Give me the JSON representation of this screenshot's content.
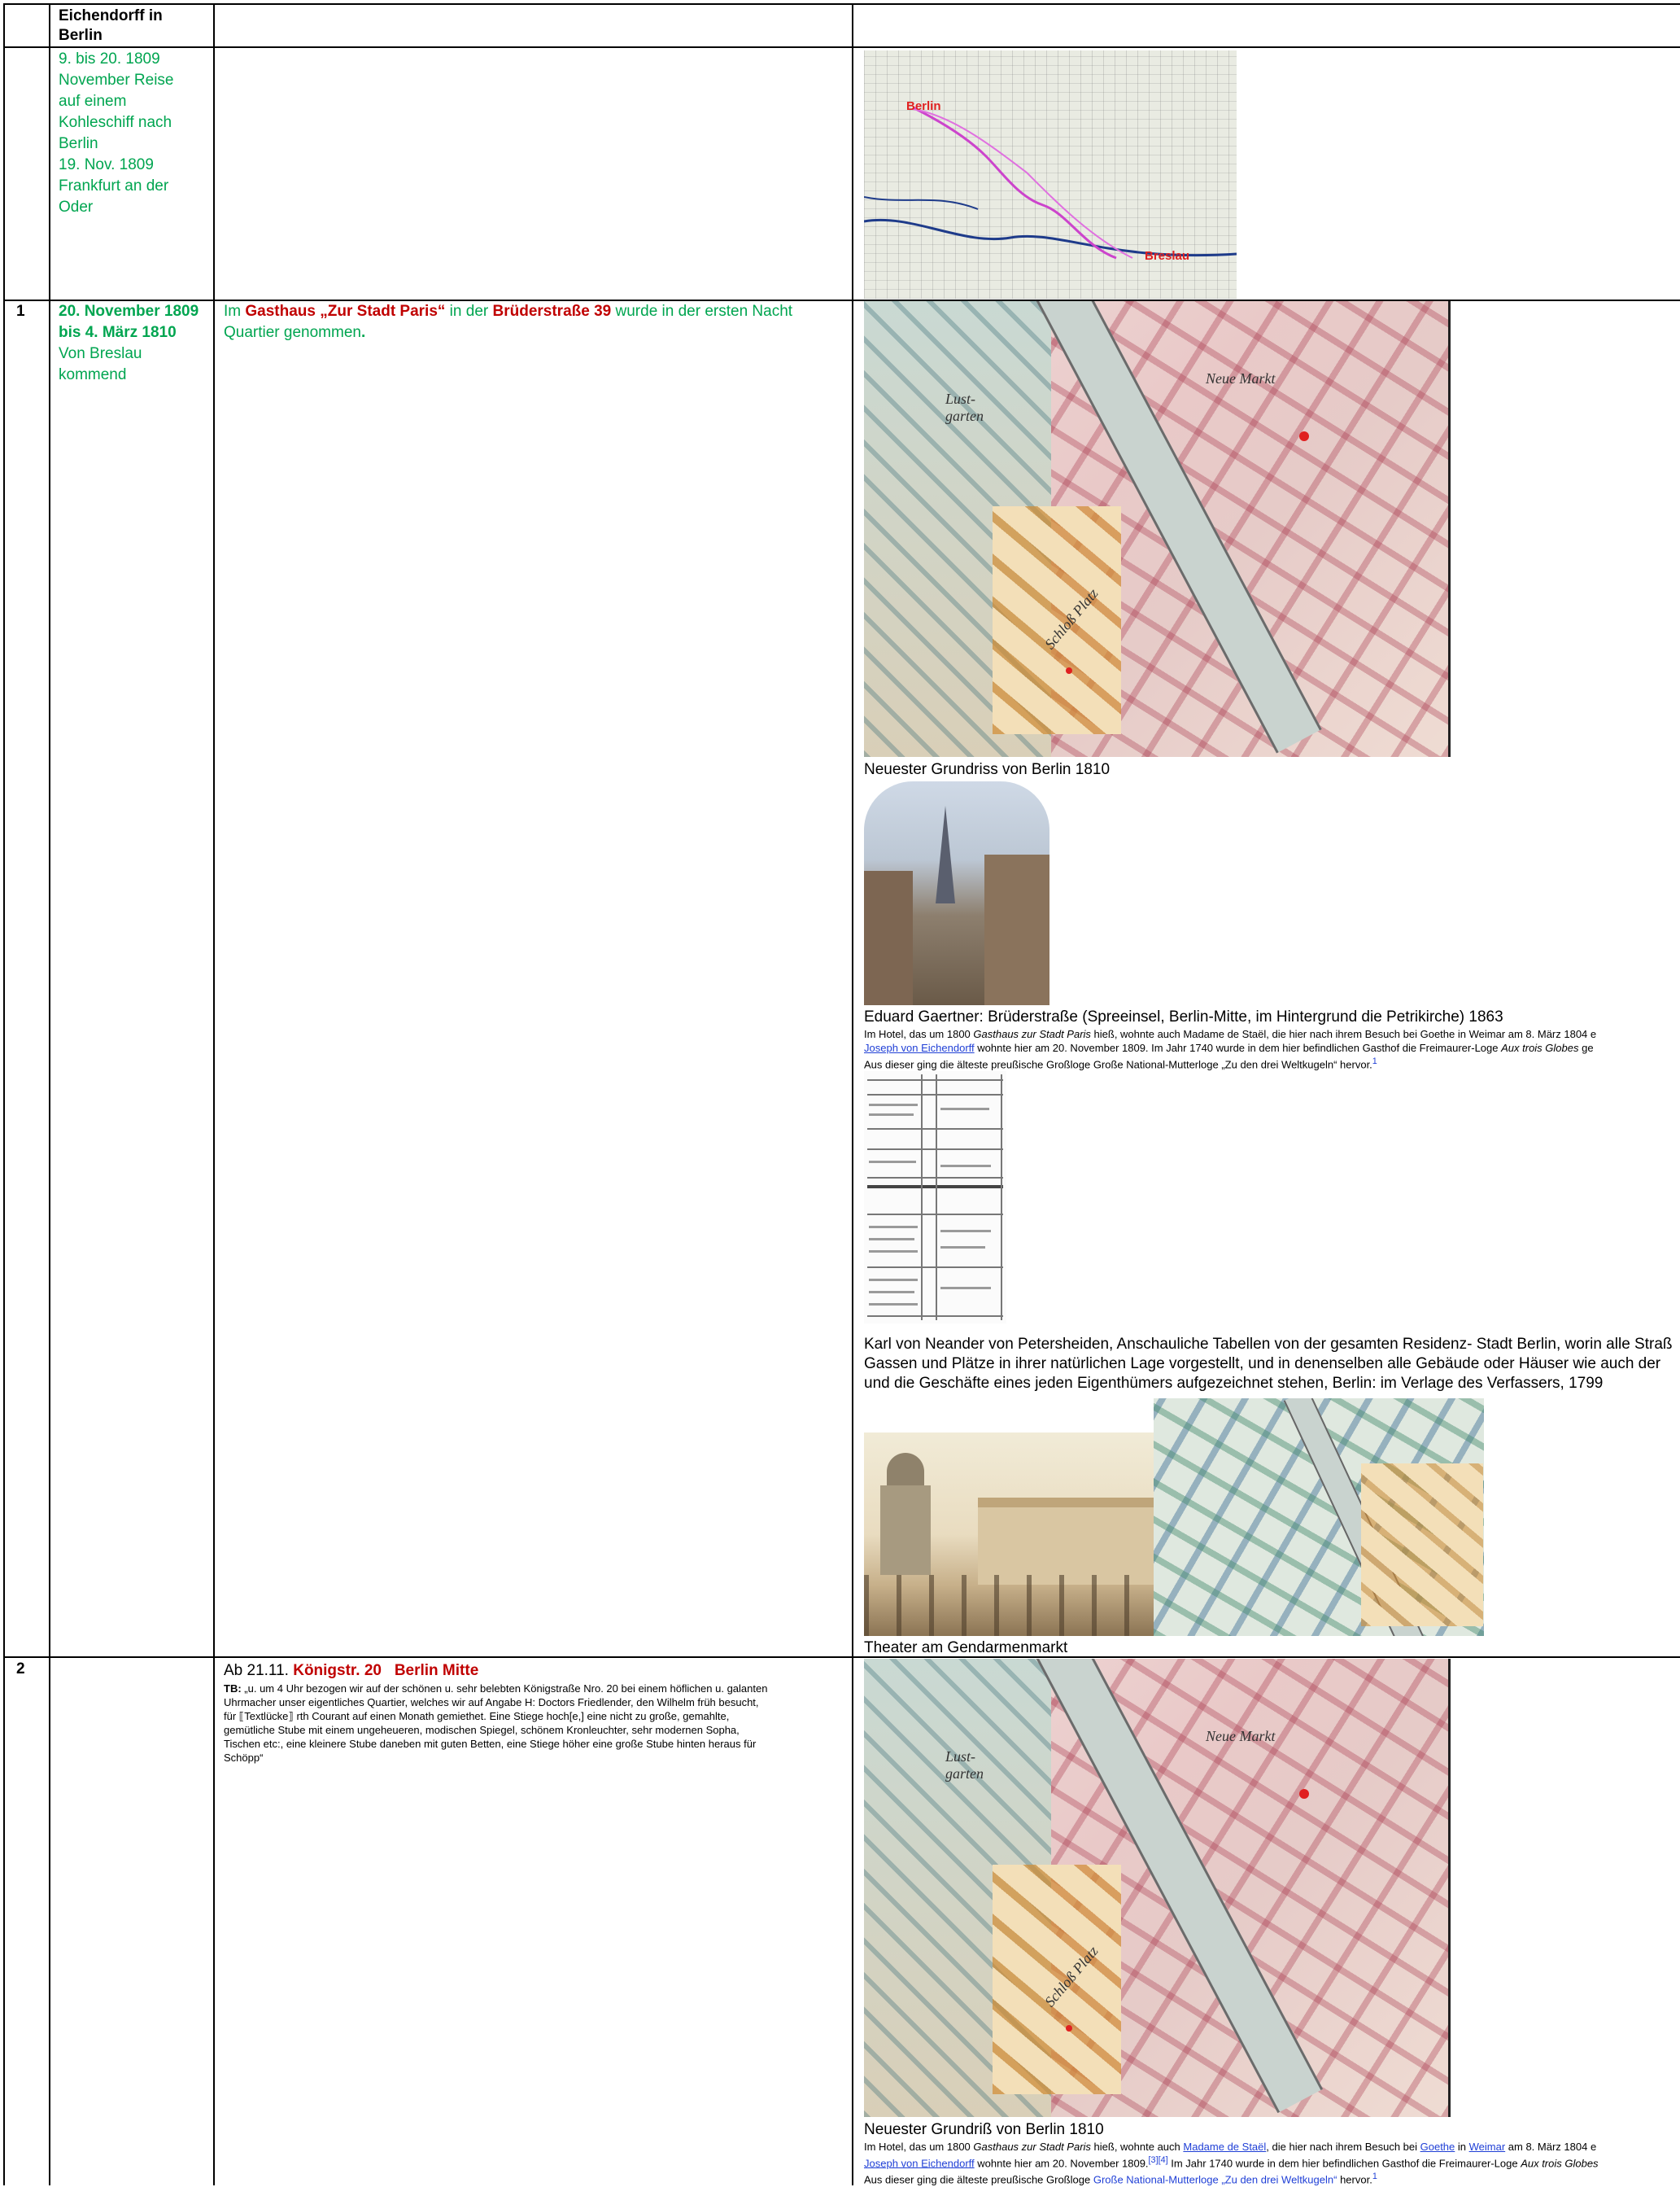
{
  "header": {
    "col2": "Eichendorff in Berlin"
  },
  "row0": {
    "date_lines": [
      "9. bis 20. 1809",
      "November Reise",
      "auf einem",
      "Kohleschiff nach",
      "Berlin",
      "19. Nov. 1809",
      "Frankfurt an der",
      "Oder"
    ],
    "map": {
      "label_berlin": "Berlin",
      "label_breslau": "Breslau"
    }
  },
  "row1": {
    "number": "1",
    "date_bold_1": "20. November 1809",
    "date_bold_2": "bis 4. März 1810",
    "date_normal_1": "Von Breslau",
    "date_normal_2": "kommend",
    "text_im": "Im ",
    "text_gasthaus": "Gasthaus „Zur Stadt Paris“",
    "text_inder": " in der ",
    "text_street": "Brüderstraße 39",
    "text_rest": " wurde in der ersten Nacht",
    "text_line2": "Quartier genommen",
    "text_dot": ".",
    "map_caption": "Neuester Grundriss von Berlin 1810",
    "painting_caption": "Eduard Gaertner: Brüderstraße (Spreeinsel, Berlin-Mitte, im Hintergrund die Petrikirche) 1863",
    "hotel_l1_a": "Im Hotel, das um 1800 ",
    "hotel_l1_b": "Gasthaus zur Stadt Paris",
    "hotel_l1_c": " hieß, wohnte auch Madame de Staël, die hier nach ihrem Besuch bei Goethe in Weimar am 8. März 1804 e",
    "hotel_l2_link": "Joseph von Eichendorff",
    "hotel_l2_rest_a": " wohnte hier am 20. November 1809. Im Jahr 1740 wurde in dem hier befindlichen Gasthof die Freimaurer-Loge ",
    "hotel_l2_rest_b": "Aux trois Globes",
    "hotel_l2_rest_c": " ge",
    "hotel_l3": "Aus dieser ging die älteste preußische Großloge Große National-Mutterloge „Zu den drei Weltkugeln“ hervor.",
    "hotel_l3_ref": "1",
    "tables_caption_1": "Karl von Neander von Petersheiden, Anschauliche Tabellen von der gesamten Residenz- Stadt Berlin, worin alle Straß",
    "tables_caption_2": "Gassen und Plätze in ihrer natürlichen Lage vorgestellt, und in denenselben alle Gebäude oder Häuser wie auch der",
    "tables_caption_3": "und die Geschäfte eines jeden Eigenthümers aufgezeichnet stehen, Berlin: im Verlage des Verfassers, 1799",
    "theater_caption": "Theater am Gendarmenmarkt"
  },
  "row2": {
    "number": "2",
    "addr_a": "Ab 21.11. ",
    "addr_b": "Königstr. 20",
    "addr_c": "Berlin Mitte",
    "tb_label": "TB:",
    "tb_lines": [
      " „u. um 4 Uhr bezogen wir auf der schönen u. sehr belebten Königstraße Nro. 20 bei einem höflichen u. galanten",
      "Uhrmacher unser eigentliches Quartier, welches wir auf Angabe H: Doctors Friedlender, den Wilhelm früh besucht,",
      "für ⟦Textlücke⟧ rth Courant auf einen Monath gemiethet. Eine Stiege hoch[e,] eine nicht zu große, gemahlte,",
      "gemütliche Stube mit einem ungeheueren, modischen Spiegel, schönem Kronleuchter, sehr modernen Sopha,",
      "Tischen etc:, eine kleinere Stube daneben mit guten Betten, eine Stiege höher eine große Stube hinten heraus für",
      "Schöpp“"
    ],
    "map_caption": "Neuester Grundriß von Berlin 1810",
    "hotel_l1_a": "Im Hotel, das um 1800 ",
    "hotel_l1_b": "Gasthaus zur Stadt Paris",
    "hotel_l1_c": " hieß, wohnte auch ",
    "hotel_l1_link1": "Madame de Staël",
    "hotel_l1_d": ", die hier nach ihrem Besuch bei ",
    "hotel_l1_link2": "Goethe",
    "hotel_l1_e": " in ",
    "hotel_l1_link3": "Weimar",
    "hotel_l1_f": " am 8. März 1804 e",
    "hotel_l2_link": "Joseph von Eichendorff",
    "hotel_l2_rest_a": " wohnte hier am 20. November 1809.",
    "hotel_l2_ref": "[3][4]",
    "hotel_l2_rest_b": " Im Jahr 1740 wurde in dem hier befindlichen Gasthof die Freimaurer-Loge ",
    "hotel_l2_rest_c": "Aux trois Globes",
    "hotel_l3_a": "Aus dieser ging die älteste preußische Großloge ",
    "hotel_l3_link": "Große National-Mutterloge „Zu den drei Weltkugeln“",
    "hotel_l3_b": " hervor.",
    "hotel_l3_ref": "1"
  },
  "colors": {
    "green_text": "#00a550",
    "red_text": "#c00000",
    "link_blue": "#1f3fd6"
  }
}
